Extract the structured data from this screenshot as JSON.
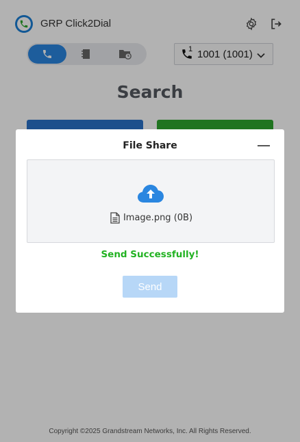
{
  "app": {
    "title": "GRP Click2Dial"
  },
  "header": {
    "settings_icon": "gear-icon",
    "logout_icon": "logout-icon"
  },
  "tabs": [
    {
      "name": "call",
      "icon": "phone-icon",
      "active": true
    },
    {
      "name": "contacts",
      "icon": "contacts-icon",
      "active": false
    },
    {
      "name": "history",
      "icon": "call-history-icon",
      "active": false
    }
  ],
  "line_selector": {
    "icon_badge": "1",
    "selected": "1001 (1001)"
  },
  "main": {
    "search_title": "Search"
  },
  "footer": {
    "copyright": "Copyright ©2025 Grandstream Networks, Inc. All Rights Reserved."
  },
  "modal": {
    "title": "File Share",
    "file_name": "Image.png (0B)",
    "status": "Send Successfully!",
    "send_label": "Send"
  },
  "colors": {
    "accent_blue": "#2a86e0",
    "success_green": "#22b222",
    "send_disabled": "#b7d7f7"
  }
}
